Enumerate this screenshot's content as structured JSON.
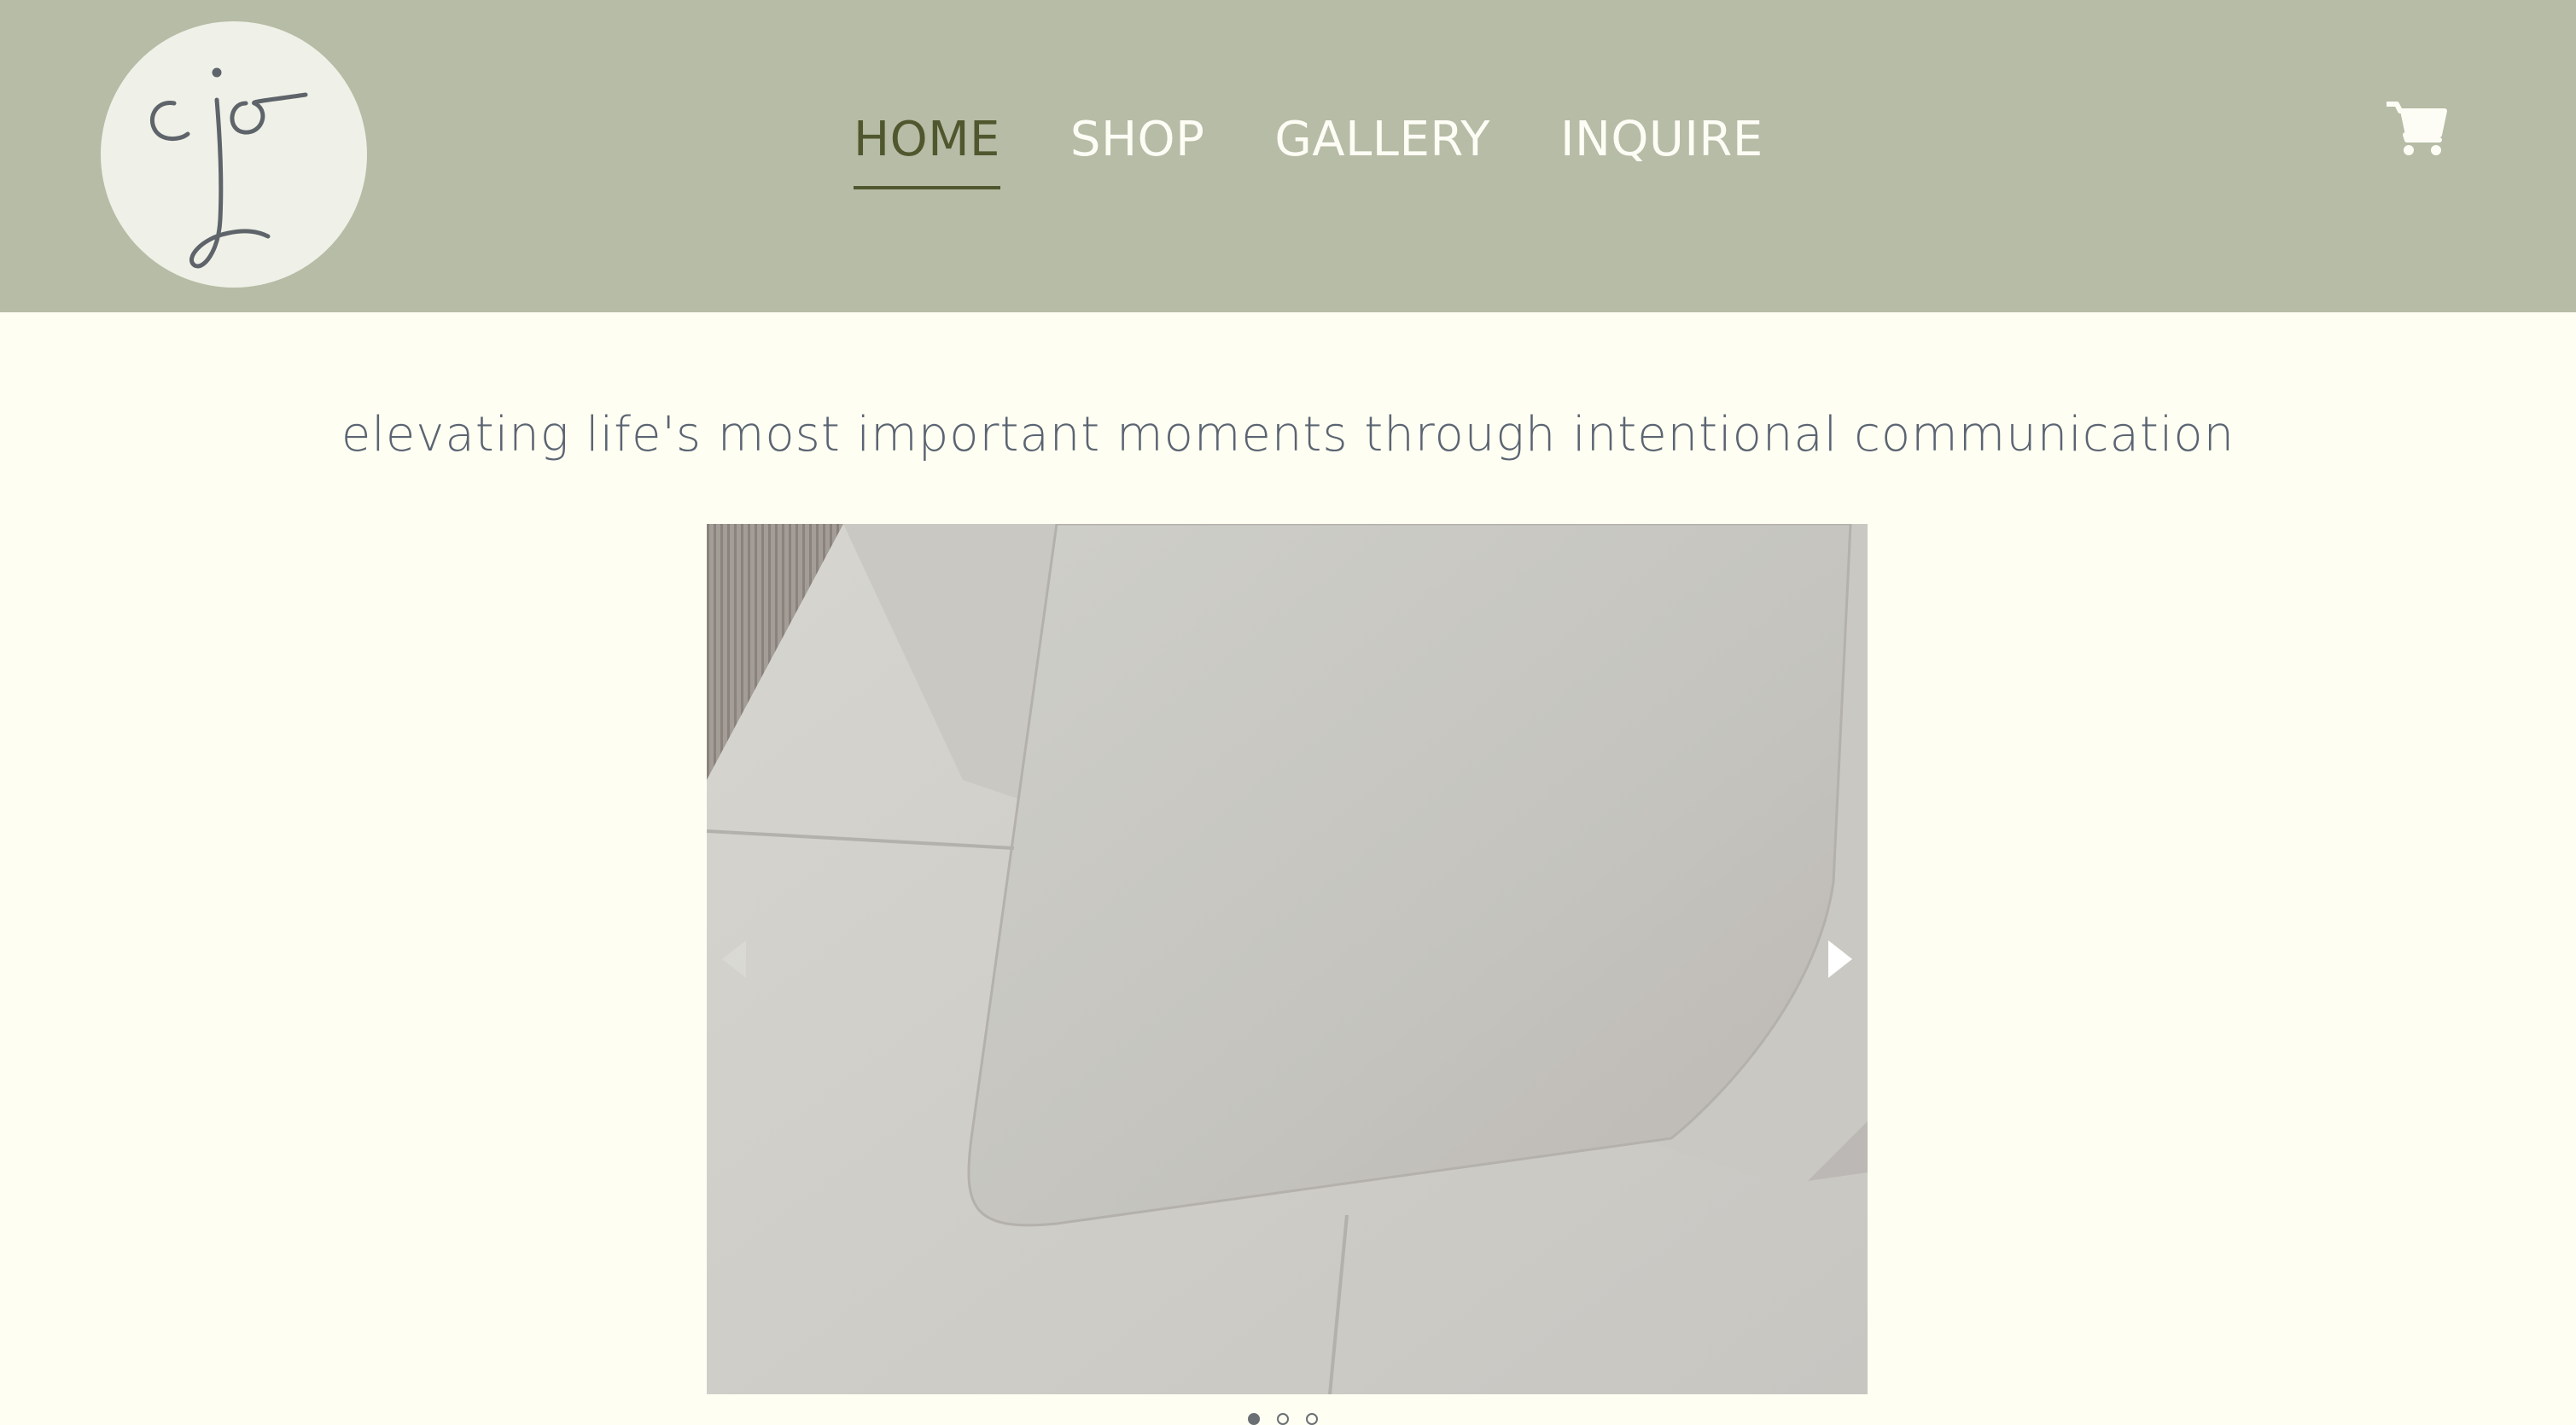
{
  "site": {
    "logo_text": "jo",
    "logo_icon": "jo-monogram-logo"
  },
  "nav": {
    "items": [
      {
        "label": "HOME",
        "active": true
      },
      {
        "label": "SHOP",
        "active": false
      },
      {
        "label": "GALLERY",
        "active": false
      },
      {
        "label": "INQUIRE",
        "active": false
      }
    ]
  },
  "cart": {
    "icon": "shopping-cart-icon"
  },
  "hero": {
    "tagline": "elevating life's most important moments through intentional communication"
  },
  "slideshow": {
    "image_subject": "stack of white envelopes on striped paper",
    "prev_icon": "caret-left-icon",
    "next_icon": "caret-right-icon",
    "slide_count": 3,
    "active_slide": 1
  },
  "colors": {
    "header_bg": "#b6bca5",
    "page_bg": "#fefff2",
    "active_nav": "#50572e",
    "nav_text": "#fdfdf6",
    "tagline_text": "#5b6472",
    "logo_circle": "#eff1e8",
    "logo_stroke": "#5e646a"
  }
}
